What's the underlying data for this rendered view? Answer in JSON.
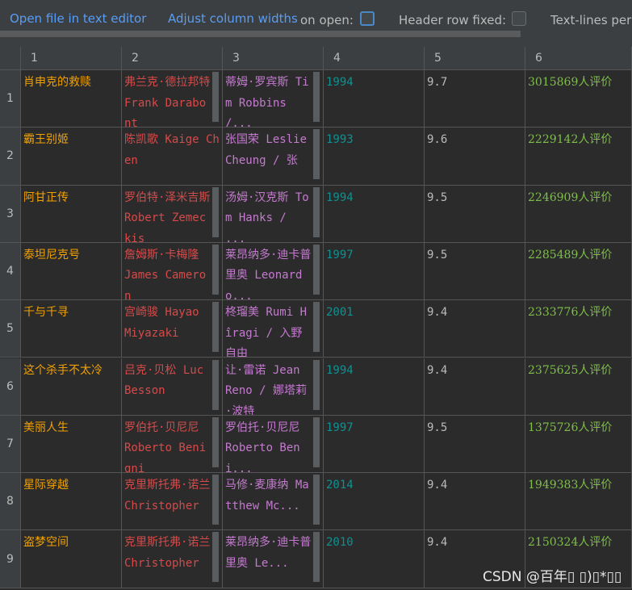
{
  "toolbar": {
    "open_editor": "Open file in text editor",
    "adjust_widths": "Adjust column widths",
    "on_open": "on open:",
    "header_fixed": "Header row fixed:",
    "text_lines": "Text-lines per"
  },
  "columns": [
    "1",
    "2",
    "3",
    "4",
    "5",
    "6"
  ],
  "rows": [
    {
      "num": "1",
      "title": "肖申克的救赎",
      "director": "弗兰克·德拉邦特 Frank Darabont",
      "actors": "蒂姆·罗宾斯 Tim Robbins /...",
      "year": "1994",
      "rating": "9.7",
      "reviews": "3015869人评价"
    },
    {
      "num": "2",
      "title": "霸王别姬",
      "director": "陈凯歌 Kaige Chen",
      "actors": "张国荣 Leslie Cheung / 张",
      "year": "1993",
      "rating": "9.6",
      "reviews": "2229142人评价"
    },
    {
      "num": "3",
      "title": "阿甘正传",
      "director": "罗伯特·泽米吉斯 Robert Zemeckis",
      "actors": "汤姆·汉克斯 Tom Hanks / ...",
      "year": "1994",
      "rating": "9.5",
      "reviews": "2246909人评价"
    },
    {
      "num": "4",
      "title": "泰坦尼克号",
      "director": "詹姆斯·卡梅隆 James Cameron",
      "actors": "莱昂纳多·迪卡普里奥 Leonardo...",
      "year": "1997",
      "rating": "9.5",
      "reviews": "2285489人评价"
    },
    {
      "num": "5",
      "title": "千与千寻",
      "director": "宫崎骏 Hayao Miyazaki",
      "actors": "柊瑠美 Rumi Hîragi / 入野自由",
      "year": "2001",
      "rating": "9.4",
      "reviews": "2333776人评价"
    },
    {
      "num": "6",
      "title": "这个杀手不太冷",
      "director": "吕克·贝松 Luc Besson",
      "actors": "让·雷诺 Jean Reno / 娜塔莉·波特",
      "year": "1994",
      "rating": "9.4",
      "reviews": "2375625人评价"
    },
    {
      "num": "7",
      "title": "美丽人生",
      "director": "罗伯托·贝尼尼 Roberto Benigni",
      "actors": "罗伯托·贝尼尼 Roberto Beni...",
      "year": "1997",
      "rating": "9.5",
      "reviews": "1375726人评价"
    },
    {
      "num": "8",
      "title": "星际穿越",
      "director": "克里斯托弗·诺兰 Christopher",
      "actors": "马修·麦康纳 Matthew Mc...",
      "year": "2014",
      "rating": "9.4",
      "reviews": "1949383人评价"
    },
    {
      "num": "9",
      "title": "盗梦空间",
      "director": "克里斯托弗·诺兰 Christopher",
      "actors": "莱昂纳多·迪卡普里奥 Le...",
      "year": "2010",
      "rating": "9.4",
      "reviews": "2150324人评价"
    }
  ],
  "watermark": "CSDN @百年▯ ▯)▯*▯▯"
}
